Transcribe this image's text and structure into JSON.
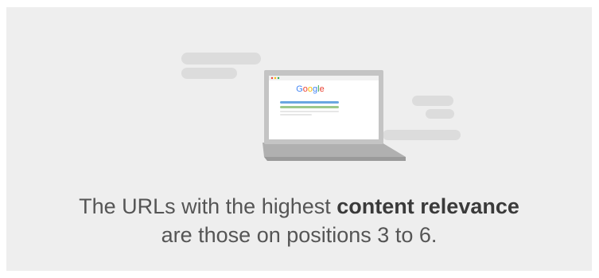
{
  "illustration": {
    "browser_logo_text": "Google",
    "logo_colors": [
      "#4285F4",
      "#EA4335",
      "#FBBC05",
      "#4285F4",
      "#34A853",
      "#EA4335"
    ],
    "colors": {
      "background": "#eeeeee",
      "cloud": "#dcdcdc",
      "laptop_body": "#c4c4c4",
      "laptop_base": "#b0b0b0",
      "screen": "#ffffff",
      "result_blue": "#6aa7e0",
      "result_green": "#9cc88a"
    }
  },
  "caption": {
    "line1_before": "The URLs with the highest ",
    "line1_emphasis": "content relevance",
    "line2": "are those on positions 3 to 6."
  }
}
